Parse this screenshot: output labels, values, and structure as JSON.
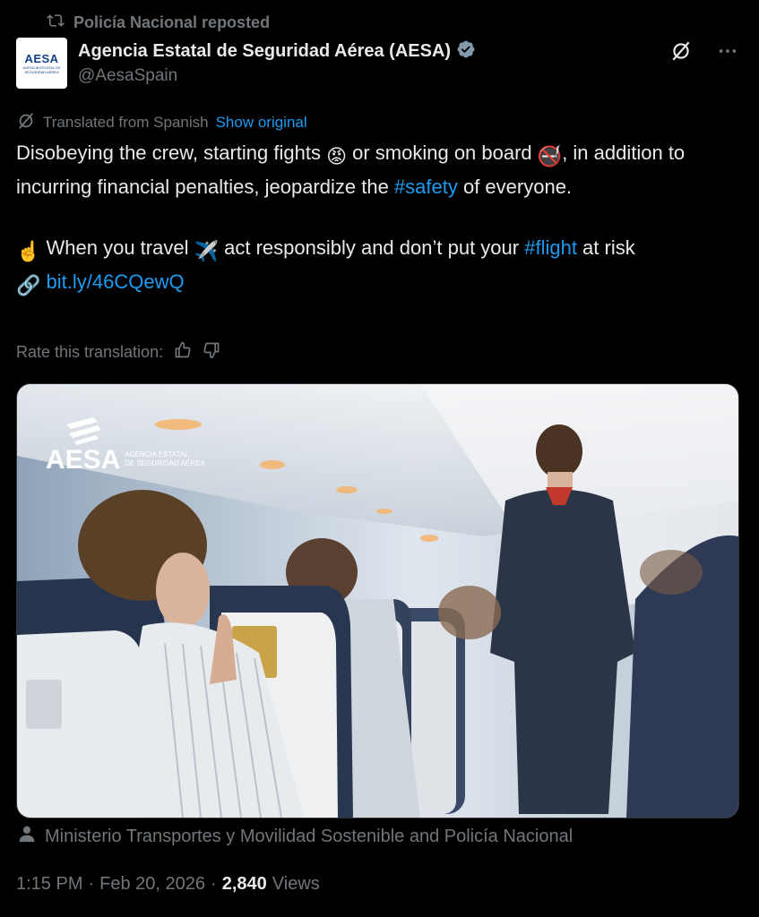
{
  "repost": {
    "text": "Policía Nacional reposted"
  },
  "author": {
    "name": "Agencia Estatal de Seguridad Aérea (AESA)",
    "handle": "@AesaSpain",
    "avatar_mark": "AESA",
    "avatar_sub": "AGENCIA ESTATAL DE SEGURIDAD AÉREA",
    "verified_icon": "verified-badge-icon"
  },
  "translation": {
    "label": "Translated from Spanish",
    "show_original": "Show original",
    "rate_label": "Rate this translation:"
  },
  "tweet": {
    "line1_a": "Disobeying the crew, starting fights ",
    "line1_b": " or smoking on board ",
    "line1_c": ", in addition to incurring financial penalties, jeopardize the ",
    "hashtag1": "#safety",
    "line1_d": " of everyone.",
    "line2_a": " When you travel ",
    "line2_b": " act responsibly and don’t put your ",
    "hashtag2": "#flight",
    "line2_c": " at risk",
    "link": "bit.ly/46CQewQ",
    "emoji_angry": "😡",
    "emoji_nosmoking": "🚭",
    "emoji_finger": "☝️",
    "emoji_plane": "✈️",
    "emoji_link": "🔗"
  },
  "media": {
    "logo_text": "AESA",
    "logo_sub1": "AGENCIA ESTATAL",
    "logo_sub2": "DE SEGURIDAD AÉREA"
  },
  "credit": {
    "text": "Ministerio Transportes y Movilidad Sostenible and Policía Nacional"
  },
  "meta": {
    "time": "1:15 PM",
    "sep1": "·",
    "date": "Feb 20, 2026",
    "sep2": "·",
    "views_count": "2,840",
    "views_label": "Views"
  },
  "colors": {
    "accent": "#1d9bf0",
    "muted": "#71767b",
    "text": "#e7e9ea"
  }
}
